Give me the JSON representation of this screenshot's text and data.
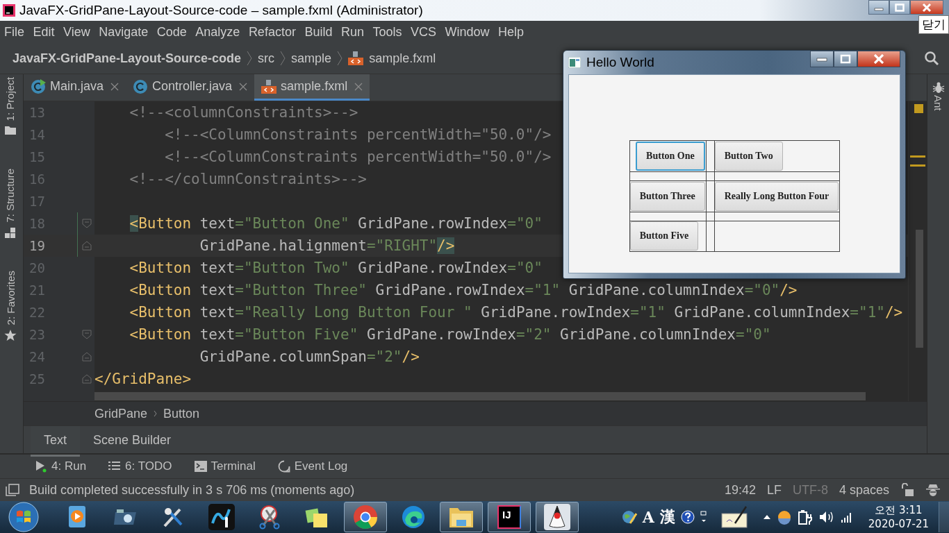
{
  "window": {
    "title": "JavaFX-GridPane-Layout-Source-code – sample.fxml (Administrator)",
    "close_tooltip": "닫기"
  },
  "menu": [
    "File",
    "Edit",
    "View",
    "Navigate",
    "Code",
    "Analyze",
    "Refactor",
    "Build",
    "Run",
    "Tools",
    "VCS",
    "Window",
    "Help"
  ],
  "navigation": {
    "project": "JavaFX-GridPane-Layout-Source-code",
    "path": [
      "src",
      "sample"
    ],
    "file": "sample.fxml"
  },
  "left_tool_strip": [
    {
      "label": "1: Project",
      "kind": "folder"
    },
    {
      "label": "7: Structure",
      "kind": "structure"
    },
    {
      "label": "2: Favorites",
      "kind": "star"
    }
  ],
  "right_tool_strip": [
    {
      "label": "Ant"
    }
  ],
  "tabs": [
    {
      "label": "Main.java",
      "kind": "java-run",
      "selected": false
    },
    {
      "label": "Controller.java",
      "kind": "java",
      "selected": false
    },
    {
      "label": "sample.fxml",
      "kind": "fxml",
      "selected": true
    }
  ],
  "editor": {
    "lines": [
      {
        "number": "13",
        "current": false,
        "changed": false,
        "fold_start": false,
        "fold_end": false,
        "tokens": [
          {
            "text": "    <!--<columnConstraints>-->",
            "kind": "comment"
          }
        ]
      },
      {
        "number": "14",
        "current": false,
        "changed": false,
        "fold_start": false,
        "fold_end": false,
        "tokens": [
          {
            "text": "        <!--<ColumnConstraints percentWidth=\"50.0\"/>",
            "kind": "comment"
          }
        ]
      },
      {
        "number": "15",
        "current": false,
        "changed": false,
        "fold_start": false,
        "fold_end": false,
        "tokens": [
          {
            "text": "        <!--<ColumnConstraints percentWidth=\"50.0\"/>",
            "kind": "comment"
          }
        ]
      },
      {
        "number": "16",
        "current": false,
        "changed": false,
        "fold_start": false,
        "fold_end": false,
        "tokens": [
          {
            "text": "    <!--</columnConstraints>-->",
            "kind": "comment"
          }
        ]
      },
      {
        "number": "17",
        "current": false,
        "changed": false,
        "fold_start": false,
        "fold_end": false
      },
      {
        "number": "18",
        "current": false,
        "changed": true,
        "fold_start": true,
        "fold_end": false,
        "tokens": [
          {
            "text": "    <",
            "kind": "match"
          },
          {
            "text": "Button",
            "kind": "tag"
          },
          {
            "text": " text",
            "kind": "attr"
          },
          {
            "text": "=\"Button One\"",
            "kind": "value"
          },
          {
            "text": " GridPane.rowIndex",
            "kind": "attr"
          },
          {
            "text": "=\"0\"",
            "kind": "value"
          }
        ]
      },
      {
        "number": "19",
        "current": true,
        "changed": true,
        "fold_start": false,
        "fold_end": true,
        "tokens": [
          {
            "text": "            GridPane.halignment",
            "kind": "attr"
          },
          {
            "text": "=\"RIGHT\"",
            "kind": "value"
          },
          {
            "text": "/>",
            "kind": "match"
          }
        ]
      },
      {
        "number": "20",
        "current": false,
        "changed": false,
        "fold_start": false,
        "fold_end": false,
        "tokens": [
          {
            "text": "    <Button",
            "kind": "tag"
          },
          {
            "text": " text",
            "kind": "attr"
          },
          {
            "text": "=\"Button Two\"",
            "kind": "value"
          },
          {
            "text": " GridPane.rowIndex",
            "kind": "attr"
          },
          {
            "text": "=\"0\"",
            "kind": "value"
          }
        ]
      },
      {
        "number": "21",
        "current": false,
        "changed": false,
        "fold_start": false,
        "fold_end": false,
        "tokens": [
          {
            "text": "    <Button",
            "kind": "tag"
          },
          {
            "text": " text",
            "kind": "attr"
          },
          {
            "text": "=\"Button Three\"",
            "kind": "value"
          },
          {
            "text": " GridPane.rowIndex",
            "kind": "attr"
          },
          {
            "text": "=\"1\"",
            "kind": "value"
          },
          {
            "text": " GridPane.columnIndex",
            "kind": "attr"
          },
          {
            "text": "=\"0\"",
            "kind": "value"
          },
          {
            "text": "/>",
            "kind": "tag"
          }
        ]
      },
      {
        "number": "22",
        "current": false,
        "changed": false,
        "fold_start": false,
        "fold_end": false,
        "tokens": [
          {
            "text": "    <Button",
            "kind": "tag"
          },
          {
            "text": " text",
            "kind": "attr"
          },
          {
            "text": "=\"Really Long Button Four \"",
            "kind": "value"
          },
          {
            "text": " GridPane.rowIndex",
            "kind": "attr"
          },
          {
            "text": "=\"1\"",
            "kind": "value"
          },
          {
            "text": " GridPane.columnIndex",
            "kind": "attr"
          },
          {
            "text": "=\"1\"",
            "kind": "value"
          },
          {
            "text": "/>",
            "kind": "tag"
          }
        ]
      },
      {
        "number": "23",
        "current": false,
        "changed": false,
        "fold_start": true,
        "fold_end": false,
        "tokens": [
          {
            "text": "    <Button",
            "kind": "tag"
          },
          {
            "text": " text",
            "kind": "attr"
          },
          {
            "text": "=\"Button Five\"",
            "kind": "value"
          },
          {
            "text": " GridPane.rowIndex",
            "kind": "attr"
          },
          {
            "text": "=\"2\"",
            "kind": "value"
          },
          {
            "text": " GridPane.columnIndex",
            "kind": "attr"
          },
          {
            "text": "=\"0\"",
            "kind": "value"
          }
        ]
      },
      {
        "number": "24",
        "current": false,
        "changed": false,
        "fold_start": false,
        "fold_end": true,
        "tokens": [
          {
            "text": "            GridPane.columnSpan",
            "kind": "attr"
          },
          {
            "text": "=\"2\"",
            "kind": "value"
          },
          {
            "text": "/>",
            "kind": "tag"
          }
        ]
      },
      {
        "number": "25",
        "current": false,
        "changed": false,
        "fold_start": false,
        "fold_end": true,
        "tokens": [
          {
            "text": "</GridPane>",
            "kind": "tag"
          }
        ]
      }
    ]
  },
  "breadcrumb": [
    "GridPane",
    "Button"
  ],
  "editor_mode_tabs": [
    {
      "label": "Text",
      "selected": true
    },
    {
      "label": "Scene Builder",
      "selected": false
    }
  ],
  "tool_windows": [
    {
      "label": "4: Run",
      "kind": "run"
    },
    {
      "label": "6: TODO",
      "kind": "todo"
    },
    {
      "label": "Terminal",
      "kind": "terminal"
    },
    {
      "label": "Event Log",
      "kind": "log"
    }
  ],
  "status_bar": {
    "message": "Build completed successfully in 3 s 706 ms (moments ago)",
    "items": [
      {
        "label": "19:42",
        "disabled": false
      },
      {
        "label": "LF",
        "disabled": false
      },
      {
        "label": "UTF-8",
        "disabled": true
      },
      {
        "label": "4 spaces",
        "disabled": false
      }
    ]
  },
  "app_window": {
    "title": "Hello World",
    "grid": [
      [
        {
          "label": "Button One",
          "focused": true
        },
        {
          "label": "Button Two",
          "focused": false
        }
      ],
      [
        {
          "label": "Button Three",
          "focused": false
        },
        {
          "label": "Really Long Button Four",
          "focused": false
        }
      ],
      [
        {
          "label": "Button Five",
          "focused": false
        }
      ]
    ]
  },
  "taskbar": {
    "apps": [
      {
        "kind": "media",
        "open": false
      },
      {
        "kind": "camera",
        "open": false
      },
      {
        "kind": "tools",
        "open": false
      },
      {
        "kind": "touch",
        "open": false
      },
      {
        "kind": "scissors",
        "open": false
      },
      {
        "kind": "notes",
        "open": false
      },
      {
        "kind": "chrome",
        "open": true
      },
      {
        "kind": "edge",
        "open": false
      },
      {
        "kind": "folder",
        "open": true
      },
      {
        "kind": "ij",
        "open": true,
        "label": "IJ"
      },
      {
        "kind": "duke",
        "open": true
      }
    ],
    "tray_texts": [
      "A",
      "漢"
    ],
    "clock": {
      "time": "오전 3:11",
      "date": "2020-07-21"
    }
  }
}
